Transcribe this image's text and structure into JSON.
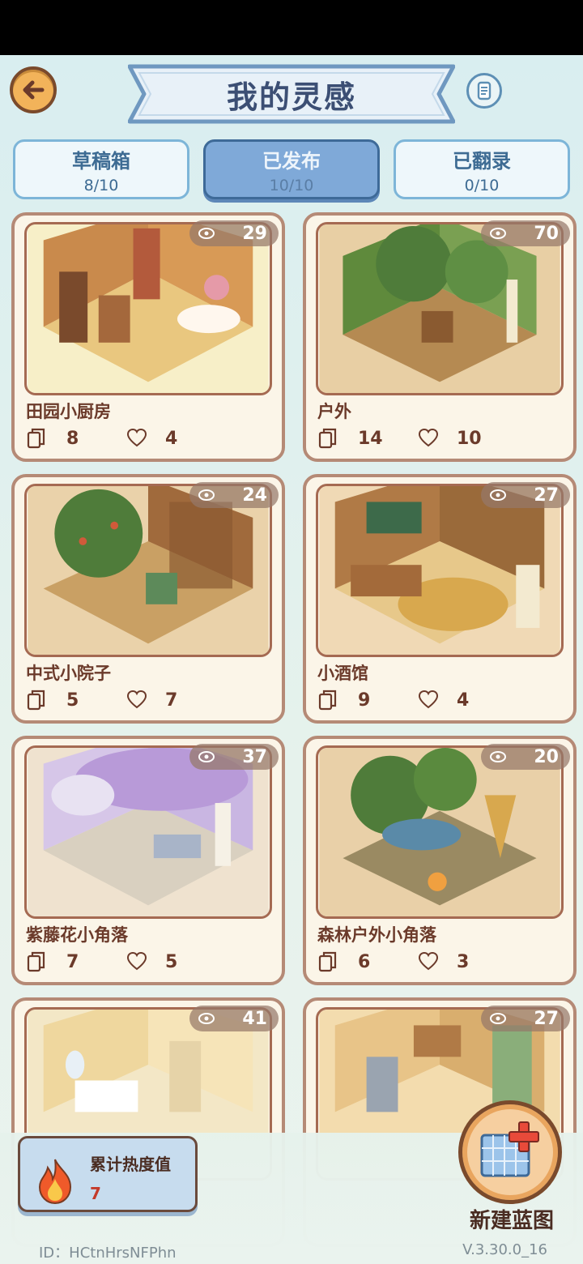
{
  "header": {
    "title": "我的灵感",
    "back_icon": "back-arrow-icon",
    "menu_icon": "scroll-icon"
  },
  "tabs": [
    {
      "label": "草稿箱",
      "count": "8/10",
      "active": false
    },
    {
      "label": "已发布",
      "count": "10/10",
      "active": true
    },
    {
      "label": "已翻录",
      "count": "0/10",
      "active": false
    }
  ],
  "cards": [
    {
      "title": "田园小厨房",
      "views": "29",
      "copies": "8",
      "likes": "4",
      "theme": "#f7e3b6"
    },
    {
      "title": "户外",
      "views": "70",
      "copies": "14",
      "likes": "10",
      "theme": "#e9d0a6"
    },
    {
      "title": "中式小院子",
      "views": "24",
      "copies": "5",
      "likes": "7",
      "theme": "#ead2aa"
    },
    {
      "title": "小酒馆",
      "views": "27",
      "copies": "9",
      "likes": "4",
      "theme": "#f0d9b5"
    },
    {
      "title": "紫藤花小角落",
      "views": "37",
      "copies": "7",
      "likes": "5",
      "theme": "#efe2cf"
    },
    {
      "title": "森林户外小角落",
      "views": "20",
      "copies": "6",
      "likes": "3",
      "theme": "#e9d0a8"
    },
    {
      "title": "",
      "views": "41",
      "copies": "",
      "likes": "",
      "theme": "#f3e7c6"
    },
    {
      "title": "",
      "views": "27",
      "copies": "",
      "likes": "",
      "theme": "#f3dcae"
    }
  ],
  "heat": {
    "label": "累计热度值",
    "value": "7"
  },
  "new_blueprint": {
    "label": "新建蓝图"
  },
  "footer": {
    "id": "ID：HCtnHrsNFPhn",
    "version": "V.3.30.0_16"
  },
  "colors": {
    "accent_brown": "#6b3a2a",
    "tab_active": "#7fa9d8",
    "background": "#d9eef0"
  }
}
